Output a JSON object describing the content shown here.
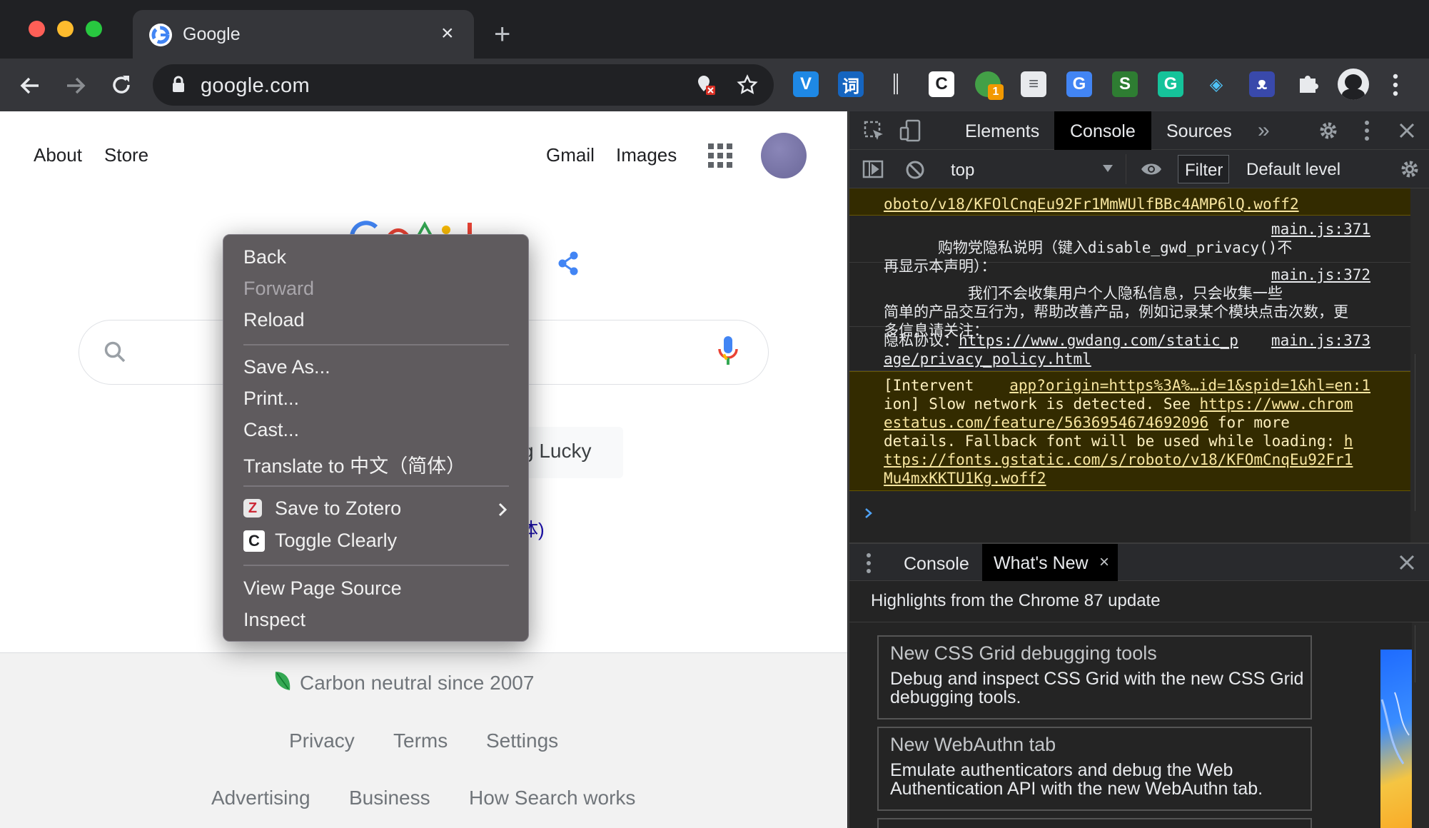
{
  "tab": {
    "title": "Google"
  },
  "omnibox": {
    "url": "google.com"
  },
  "extensions": [
    {
      "name": "vimium-icon",
      "glyph": "V",
      "bg": "#1e88e5",
      "fg": "#ffffff"
    },
    {
      "name": "dictionary-icon",
      "glyph": "词",
      "bg": "#1565c0",
      "fg": "#ffffff"
    },
    {
      "name": "barcode-icon",
      "glyph": "║",
      "bg": "transparent",
      "fg": "#e8eaed"
    },
    {
      "name": "clearly-ext-icon",
      "glyph": "C",
      "bg": "#ffffff",
      "fg": "#202124"
    },
    {
      "name": "gwdang-icon",
      "glyph": "",
      "bg": "#43a047",
      "fg": "#ffffff",
      "badge": "1"
    },
    {
      "name": "page-icon",
      "glyph": "≡",
      "bg": "#e8eaed",
      "fg": "#5f6368"
    },
    {
      "name": "google-translate-icon",
      "glyph": "G",
      "bg": "#4285f4",
      "fg": "#ffffff"
    },
    {
      "name": "s-ext-icon",
      "glyph": "S",
      "bg": "#2e7d32",
      "fg": "#ffffff"
    },
    {
      "name": "grammarly-icon",
      "glyph": "G",
      "bg": "#15c39a",
      "fg": "#ffffff"
    },
    {
      "name": "layers-icon",
      "glyph": "◈",
      "bg": "transparent",
      "fg": "#4fc3f7"
    },
    {
      "name": "cat-icon",
      "glyph": "ᴥ",
      "bg": "#3949ab",
      "fg": "#ffffff"
    }
  ],
  "google": {
    "top_left": [
      "About",
      "Store"
    ],
    "top_right": [
      "Gmail",
      "Images"
    ],
    "lucky": "g Lucky",
    "lang_fragment": "体)",
    "carbon": "Carbon neutral since 2007",
    "footer_row1": [
      "Privacy",
      "Terms",
      "Settings"
    ],
    "footer_row2": [
      "Advertising",
      "Business",
      "How Search works"
    ]
  },
  "context_menu": {
    "back": "Back",
    "forward": "Forward",
    "reload": "Reload",
    "save_as": "Save As...",
    "print": "Print...",
    "cast": "Cast...",
    "translate": "Translate to 中文（简体）",
    "zotero": "Save to Zotero",
    "clearly": "Toggle Clearly",
    "view_source": "View Page Source",
    "inspect": "Inspect"
  },
  "devtools": {
    "tabs": [
      "Elements",
      "Console",
      "Sources"
    ],
    "active_tab": "Console",
    "context": "top",
    "filter": "Filter",
    "level": "Default level",
    "messages": {
      "m0_text": "oboto/v18/KFOlCnqEu92Fr1MmWUlfBBc4AMP6lQ.woff2",
      "m1_text": "购物党隐私说明（键入disable_gwd_privacy()不\n再显示本声明）：",
      "m1_src": "main.js:371",
      "m2_text": "　　我们不会收集用户个人隐私信息，只会收集一些\n简单的产品交互行为，帮助改善产品，例如记录某个模块点击次数，更\n多信息请关注：",
      "m2_src": "main.js:372",
      "m3_label": "隐私协议：",
      "m3_link1": "https://www.gwdang.com/static_p",
      "m3_link2": "age/privacy_policy.html",
      "m3_src": "main.js:373",
      "m4_l1": "[Intervent",
      "m4_src": "app?origin=https%3A%…id=1&spid=1&hl=en:1",
      "m4_l2a": "ion] Slow network is detected. See ",
      "m4_l2b": "https://www.chrom",
      "m4_l3a": "estatus.com/feature/5636954674692096",
      "m4_l3b": " for more",
      "m4_l4a": "details. Fallback font will be used while loading: ",
      "m4_l4b": "h",
      "m4_l5": "ttps://fonts.gstatic.com/s/roboto/v18/KFOmCnqEu92Fr1",
      "m4_l6": "Mu4mxKKTU1Kg.woff2"
    },
    "drawer_tabs": [
      "Console",
      "What's New"
    ],
    "highlights": "Highlights from the Chrome 87 update",
    "cards": [
      {
        "title": "New CSS Grid debugging tools",
        "body": "Debug and inspect CSS Grid with the new CSS Grid debugging tools."
      },
      {
        "title": "New WebAuthn tab",
        "body": "Emulate authenticators and debug the Web Authentication API with the new WebAuthn tab."
      }
    ]
  }
}
